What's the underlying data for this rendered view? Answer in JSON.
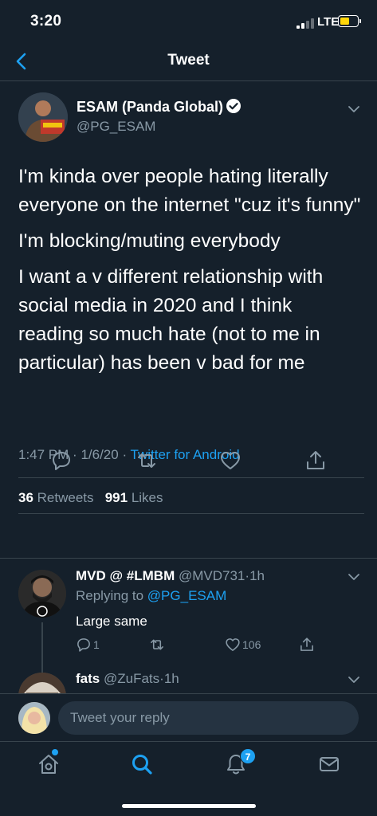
{
  "status_bar": {
    "time": "3:20",
    "network": "LTE"
  },
  "nav": {
    "title": "Tweet",
    "back_icon": "chevron-left-icon"
  },
  "tweet": {
    "author_name": "ESAM (Panda Global)",
    "author_handle": "@PG_ESAM",
    "verified": true,
    "paragraphs": [
      "I'm kinda over people hating literally everyone on the internet \"cuz it's funny\"",
      "I'm blocking/muting everybody",
      "I want a v different relationship with social media in 2020 and I think reading so much hate (not to me in particular) has been v bad for me"
    ],
    "time": "1:47 PM",
    "date": "1/6/20",
    "separator": "·",
    "source": "Twitter for Android",
    "retweets_count": "36",
    "retweets_label": "Retweets",
    "likes_count": "991",
    "likes_label": "Likes"
  },
  "replies": [
    {
      "name": "MVD @ #LMBM",
      "handle": "@MVD731",
      "time": "1h",
      "replying_prefix": "Replying to",
      "replying_to": "@PG_ESAM",
      "text": "Large same",
      "reply_count": "1",
      "retweet_count": "",
      "like_count": "106"
    },
    {
      "name": "fats",
      "handle": "@ZuFats",
      "time": "1h"
    }
  ],
  "composer": {
    "placeholder": "Tweet your reply"
  },
  "tab_bar": {
    "notifications_badge": "7"
  },
  "colors": {
    "background": "#15202b",
    "accent": "#1da1f2",
    "muted": "#8899a6",
    "border": "#38444d",
    "battery": "#ffd60a"
  }
}
